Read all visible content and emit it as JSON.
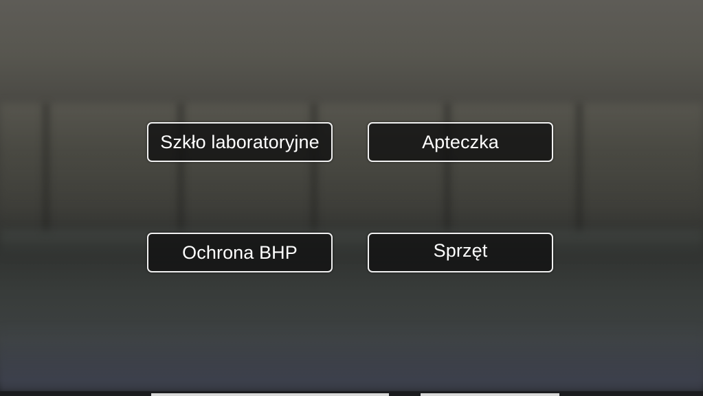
{
  "menu": {
    "buttons": [
      {
        "label": "Szkło laboratoryjne"
      },
      {
        "label": "Apteczka"
      },
      {
        "label": "Ochrona BHP"
      },
      {
        "label": "Sprzęt"
      }
    ]
  },
  "colors": {
    "button_border": "#f2f2f2",
    "button_fill": "#121212",
    "button_text": "#ffffff"
  }
}
